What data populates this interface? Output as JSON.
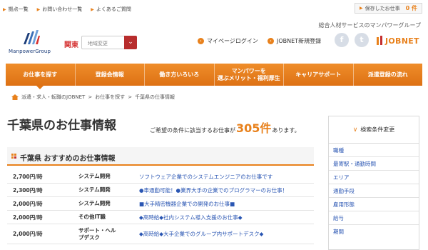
{
  "top_links": [
    {
      "label": "拠点一覧"
    },
    {
      "label": "お問い合わせ一覧"
    },
    {
      "label": "よくあるご質問"
    }
  ],
  "saved_jobs": {
    "label": "保存したお仕事",
    "count": "0 件"
  },
  "tagline": "総合人材サービスのマンパワーグループ",
  "logo": {
    "text": "ManpowerGroup"
  },
  "region": {
    "label": "関東",
    "select_placeholder": "地域変更"
  },
  "header_links": {
    "mypage": "マイページログイン",
    "jobnet_register": "JOBNET新規登録",
    "jobnet_logo": "JOBNET"
  },
  "social": {
    "facebook": "f",
    "twitter": "t"
  },
  "main_nav": [
    {
      "label": "お仕事を探す",
      "active": true
    },
    {
      "label": "登録会情報",
      "active": false
    },
    {
      "label": "働き方いろいろ",
      "active": false
    },
    {
      "label": "マンパワーを\n選ぶメリット・福利厚生",
      "active": false
    },
    {
      "label": "キャリアサポート",
      "active": false
    },
    {
      "label": "派遣登録の流れ",
      "active": false
    }
  ],
  "breadcrumb": [
    "派遣・求人・転職のJOBNET",
    "お仕事を探す",
    "千葉県の仕事情報"
  ],
  "page": {
    "title": "千葉県のお仕事情報",
    "result_prefix": "ご希望の条件に該当するお仕事が",
    "result_count": "305件",
    "result_suffix": "あります。"
  },
  "recommended": {
    "title": "千葉県 おすすめのお仕事情報",
    "jobs": [
      {
        "wage": "2,700円/時",
        "category": "システム開発",
        "title": "ソフトウェア企業でのシステムエンジニアのお仕事です"
      },
      {
        "wage": "2,300円/時",
        "category": "システム開発",
        "title": "●車通勤可能！●業界大手の企業でのプログラマーのお仕事！"
      },
      {
        "wage": "2,000円/時",
        "category": "システム開発",
        "title": "■大手精密機器企業での開発のお仕事■"
      },
      {
        "wage": "2,000円/時",
        "category": "その他IT職",
        "title": "◆高時給◆社内システム導入支援のお仕事◆"
      },
      {
        "wage": "2,000円/時",
        "category": "サポート・ヘル\nプデスク",
        "title": "◆高時給◆大手企業でのグループ内サポートデスク◆"
      }
    ]
  },
  "side_panel": {
    "heading": "検索条件変更",
    "items": [
      "職種",
      "最寄駅・通勤時間",
      "エリア",
      "通勤手段",
      "雇用形態",
      "給与",
      "期間"
    ]
  },
  "colors": {
    "accent": "#e8811c",
    "nav_gradient_top": "#ef8d2a",
    "nav_gradient_bottom": "#dd7114",
    "region_red": "#d53131",
    "link_blue": "#2a56b3"
  }
}
